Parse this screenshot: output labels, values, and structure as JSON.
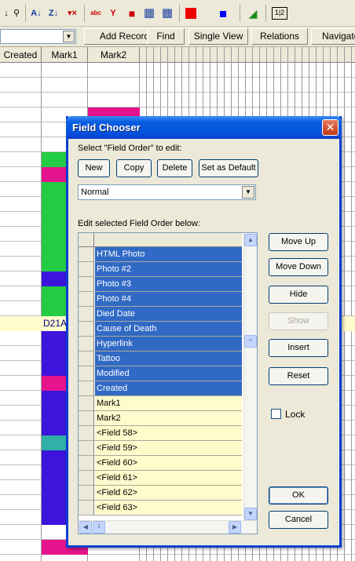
{
  "toolbar": {
    "icons": [
      "sort-icon",
      "find-icon",
      "sort-az-icon",
      "sort-za-icon",
      "filter-clear-icon",
      "spell-icon",
      "filter-red-icon",
      "grid-a-icon",
      "grid-b-icon",
      "red-square-icon",
      "blue-square-icon",
      "chart-icon",
      "numbering-icon"
    ],
    "glyphs": {
      "sort": "↓",
      "find": "⚲",
      "az": "A↓",
      "za": "Z↓",
      "filter_clear": "▾×",
      "spell": "abc",
      "filter_red": "Y",
      "grid_a": "▦",
      "grid_b": "▦",
      "chart": "◢",
      "numbering": "1|2"
    },
    "combo_value": "",
    "buttons": {
      "add_record": "Add Record",
      "find": "Find",
      "single_view": "Single View",
      "relations": "Relations",
      "navigator": "Navigato"
    }
  },
  "grid": {
    "columns": [
      "Created",
      "Mark1",
      "Mark2"
    ],
    "highlight_text": "D21A",
    "colors": {
      "green": "#22cc44",
      "pink": "#e6148c",
      "purple": "#3c14dc",
      "teal": "#2fb0a8",
      "highlight_row": "#fffbcc"
    }
  },
  "dialog": {
    "title": "Field Chooser",
    "close": "✕",
    "select_label": "Select \"Field Order\" to edit:",
    "buttons": {
      "new": "New",
      "copy": "Copy",
      "delete": "Delete",
      "set_default": "Set as Default",
      "move_up": "Move Up",
      "move_down": "Move Down",
      "hide": "Hide",
      "show": "Show",
      "insert": "Insert",
      "reset": "Reset",
      "ok": "OK",
      "cancel": "Cancel"
    },
    "order_value": "Normal",
    "edit_label": "Edit selected Field Order below:",
    "lock_label": "Lock",
    "lock_checked": false,
    "fields": [
      {
        "name": "HTML Photo",
        "selected": true
      },
      {
        "name": "Photo #2",
        "selected": true
      },
      {
        "name": "Photo #3",
        "selected": true
      },
      {
        "name": "Photo #4",
        "selected": true
      },
      {
        "name": "Died Date",
        "selected": true
      },
      {
        "name": "Cause of Death",
        "selected": true
      },
      {
        "name": "Hyperlink",
        "selected": true
      },
      {
        "name": "Tattoo",
        "selected": true
      },
      {
        "name": "Modified",
        "selected": true
      },
      {
        "name": "Created",
        "selected": true
      },
      {
        "name": "Mark1",
        "selected": false
      },
      {
        "name": "Mark2",
        "selected": false
      },
      {
        "name": "<Field 58>",
        "selected": false
      },
      {
        "name": "<Field 59>",
        "selected": false
      },
      {
        "name": "<Field 60>",
        "selected": false
      },
      {
        "name": "<Field 61>",
        "selected": false
      },
      {
        "name": "<Field 62>",
        "selected": false
      },
      {
        "name": "<Field 63>",
        "selected": false
      }
    ]
  }
}
